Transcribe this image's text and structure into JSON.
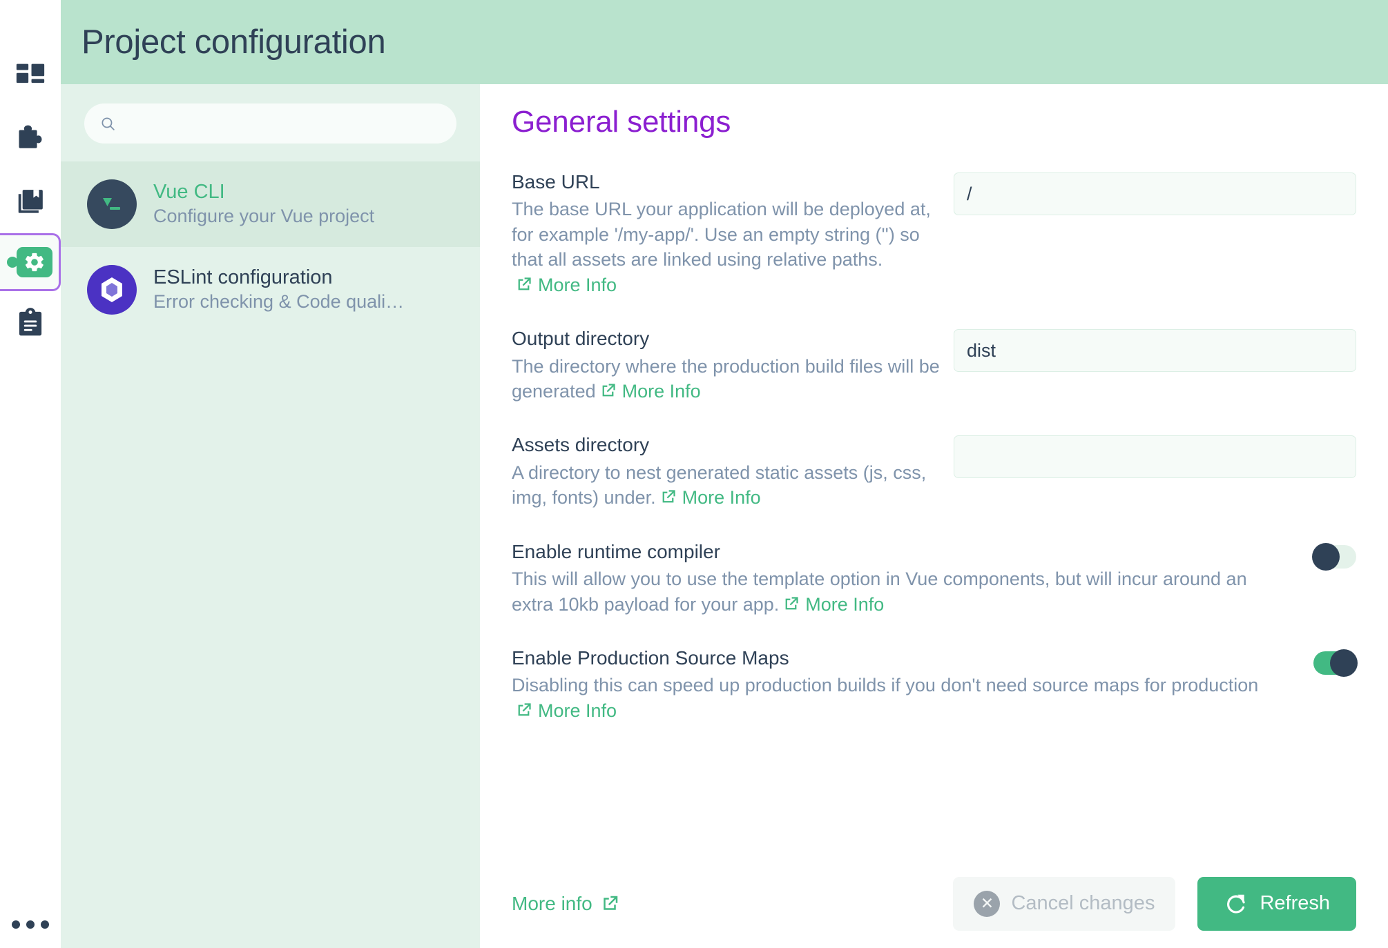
{
  "window": {
    "title": "Project configuration"
  },
  "rail": {
    "items": [
      {
        "name": "dashboard-icon",
        "label": "Dashboard",
        "active": false
      },
      {
        "name": "plugins-icon",
        "label": "Plugins",
        "active": false
      },
      {
        "name": "dependencies-icon",
        "label": "Dependencies",
        "active": false
      },
      {
        "name": "configuration-icon",
        "label": "Configuration",
        "active": true
      },
      {
        "name": "tasks-icon",
        "label": "Tasks",
        "active": false
      }
    ],
    "more_label": "More"
  },
  "search": {
    "placeholder": "",
    "value": "",
    "icon": "search-icon"
  },
  "nav": {
    "items": [
      {
        "title": "Vue CLI",
        "subtitle": "Configure your Vue project",
        "avatar": "vue-logo-icon",
        "selected": true
      },
      {
        "title": "ESLint configuration",
        "subtitle": "Error checking & Code quali…",
        "avatar": "eslint-logo-icon",
        "selected": false
      }
    ]
  },
  "main": {
    "section_title": "General settings",
    "more_info_label": "More Info",
    "fields": [
      {
        "label": "Base URL",
        "description": "The base URL your application will be deployed at, for example '/my-app/'. Use an empty string ('') so that all assets are linked using relative paths.",
        "type": "text",
        "value": "/",
        "placeholder": ""
      },
      {
        "label": "Output directory",
        "description": "The directory where the production build files will be generated",
        "type": "text",
        "value": "dist",
        "placeholder": ""
      },
      {
        "label": "Assets directory",
        "description": "A directory to nest generated static assets (js, css, img, fonts) under.",
        "type": "text",
        "value": "",
        "placeholder": ""
      },
      {
        "label": "Enable runtime compiler",
        "description": "This will allow you to use the template option in Vue components, but will incur around an extra 10kb payload for your app.",
        "type": "toggle",
        "enabled": false
      },
      {
        "label": "Enable Production Source Maps",
        "description": "Disabling this can speed up production builds if you don't need source maps for production",
        "type": "toggle",
        "enabled": true
      }
    ]
  },
  "footer": {
    "more_info_label": "More info",
    "cancel_label": "Cancel changes",
    "refresh_label": "Refresh"
  },
  "colors": {
    "accent_green": "#42b983",
    "title_bar": "#b9e3cd",
    "nav_panel": "#e3f2ea",
    "nav_selected": "#d6eade",
    "section_title": "#8b1fd0",
    "rail_active_border": "#a970e8",
    "dark": "#2f4156",
    "muted": "#7f93ab",
    "eslint_purple": "#4b32c3"
  }
}
